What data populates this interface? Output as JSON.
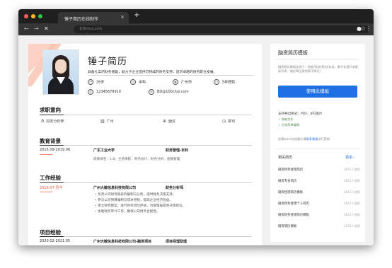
{
  "browser": {
    "tab_title": "锤子简历在线制作",
    "tab_close": "×",
    "new_tab": "+",
    "url": "100chui.com",
    "back_icon": "←",
    "forward_icon": "→",
    "stop_icon": "✕",
    "star_icon": "☆",
    "profile_icon": "●",
    "menu_icon": "⋮"
  },
  "colors": {
    "accent": "#1f6fe5",
    "deco": "#fbd2c3",
    "date_red": "#e0553c"
  },
  "resume": {
    "name": "锤子简历",
    "summary": "具备扎实的财务基础，助力于企业提供可持续的财务支持，追求卓越的财务职业发展。",
    "info": {
      "age": "26岁",
      "education": "本科",
      "city": "广州市",
      "experience": "5年经验",
      "phone": "12345678910",
      "email": "BD@100chui.com"
    },
    "intent": {
      "title": "求职意向",
      "position": "财务分析师",
      "city": "广州",
      "salary": "面议",
      "availability": "即可"
    },
    "education": {
      "title": "教育背景",
      "date": "2015.09-2019.06",
      "school": "广东工业大学",
      "major": "财务管理-本科",
      "detail": "成绩排名：1.8，主修课程：财务会计、财务分析、金融管理"
    },
    "work": {
      "title": "工作经验",
      "date": "2019.07-至今",
      "company": "广州大鲸信息科技有限公司",
      "role": "财务分析师",
      "bullets": [
        "负责公司财务报表的编制与分析，提供财务决策支持。",
        "参与公司预算编制与成本控制，提高企业经济效益。",
        "建立财务模型，进行财务风险评估，为管理层提供决策建议。",
        "协助财务审计工作，确保公司财务合规性。"
      ]
    },
    "project": {
      "title": "项目经验",
      "date": "2020.02-2021.05",
      "company": "广州大鲸信息科技有限公司-融资项目",
      "role": "项目经理助理"
    }
  },
  "sidebar": {
    "title": "融资简历模板",
    "desc_1": "融资简历模板适用于：智能/高效/原创/实用，最大化提升求职成功率，做好简历就用锤子简历！",
    "use_button": "使用此模板",
    "support": "支持导出格式：PDF、JPG图片",
    "check_1": "✓ 智能优化",
    "check_2": "✓ 在线简单编辑",
    "note_prefix": "如需word文档格式请",
    "note_link": "联系客服",
    "note_suffix": "进行获取",
    "related_title": "相关简历",
    "related_more": "更多›",
    "related": [
      {
        "title": "融资财务经理简历",
        "count": "3821人使用"
      },
      {
        "title": "融资专员简历",
        "count": "3821人使用"
      },
      {
        "title": "融资经理简历模板",
        "count": "3821人使用"
      },
      {
        "title": "融资财务经理个人简历",
        "count": "3821人使用"
      },
      {
        "title": "融资财务经理简历模板",
        "count": "3821人使用"
      },
      {
        "title": "融资简历模板",
        "count": "3232人使用"
      }
    ]
  }
}
